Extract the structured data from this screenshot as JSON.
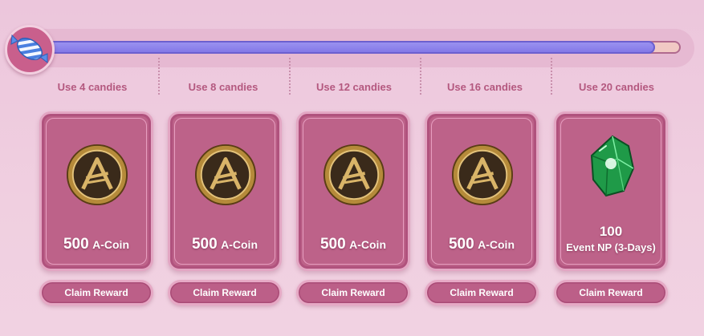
{
  "progress": {
    "fraction": 0.96
  },
  "milestones": [
    {
      "label": "Use 4 candies"
    },
    {
      "label": "Use 8 candies"
    },
    {
      "label": "Use 12 candies"
    },
    {
      "label": "Use 16 candies"
    },
    {
      "label": "Use 20 candies"
    }
  ],
  "rewards": [
    {
      "amount": "500",
      "unit": "A-Coin",
      "icon": "a-coin-icon",
      "button": "Claim Reward"
    },
    {
      "amount": "500",
      "unit": "A-Coin",
      "icon": "a-coin-icon",
      "button": "Claim Reward"
    },
    {
      "amount": "500",
      "unit": "A-Coin",
      "icon": "a-coin-icon",
      "button": "Claim Reward"
    },
    {
      "amount": "500",
      "unit": "A-Coin",
      "icon": "a-coin-icon",
      "button": "Claim Reward"
    },
    {
      "amount": "100",
      "unit": "Event NP (3-Days)",
      "icon": "emerald-gem-icon",
      "button": "Claim Reward"
    }
  ],
  "colors": {
    "bar_fill": "#8a80ec",
    "card": "#bd6289",
    "label": "#b4587f"
  }
}
